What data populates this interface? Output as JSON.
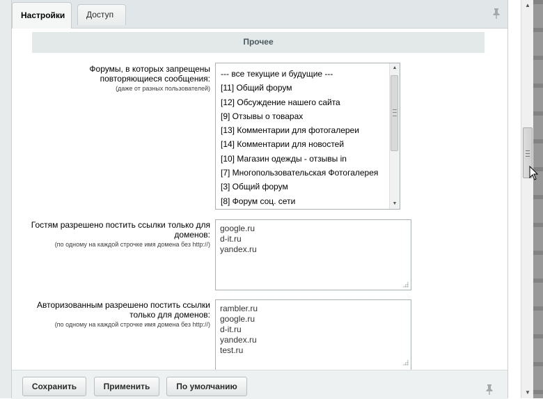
{
  "tabs": [
    {
      "label": "Настройки",
      "active": true
    },
    {
      "label": "Доступ",
      "active": false
    }
  ],
  "section": {
    "title": "Прочее"
  },
  "forums_field": {
    "label": "Форумы, в которых запрещены повторяющиеся сообщения:",
    "hint": "(даже от разных пользователей)",
    "options": [
      "--- все текущие и будущие ---",
      "[11] Общий форум",
      "[12] Обсуждение нашего сайта",
      "[9] Отзывы о товарах",
      "[13] Комментарии для фотогалереи",
      "[14] Комментарии для новостей",
      "[10] Магазин одежды - отзывы in",
      "[7] Многопользовательская Фотогалерея",
      "[3] Общий форум",
      "[8] Форум соц. сети"
    ]
  },
  "guest_domains": {
    "label": "Гостям разрешено постить ссылки только для доменов:",
    "hint": "(по одному на каждой строчке имя домена без http://)",
    "lines": [
      "google.ru",
      "d-it.ru",
      "yandex.ru"
    ]
  },
  "auth_domains": {
    "label": "Авторизованным разрешено постить ссылки только для доменов:",
    "hint": "(по одному на каждой строчке имя домена без http://)",
    "lines": [
      "rambler.ru",
      "google.ru",
      "d-it.ru",
      "yandex.ru",
      "test.ru"
    ]
  },
  "buttons": {
    "save": "Сохранить",
    "apply": "Применить",
    "default": "По умолчанию"
  },
  "colors": {
    "tab_bar": "#e1e6e8",
    "section_header": "#e3e8e9",
    "section_title": "#4b5a60"
  }
}
